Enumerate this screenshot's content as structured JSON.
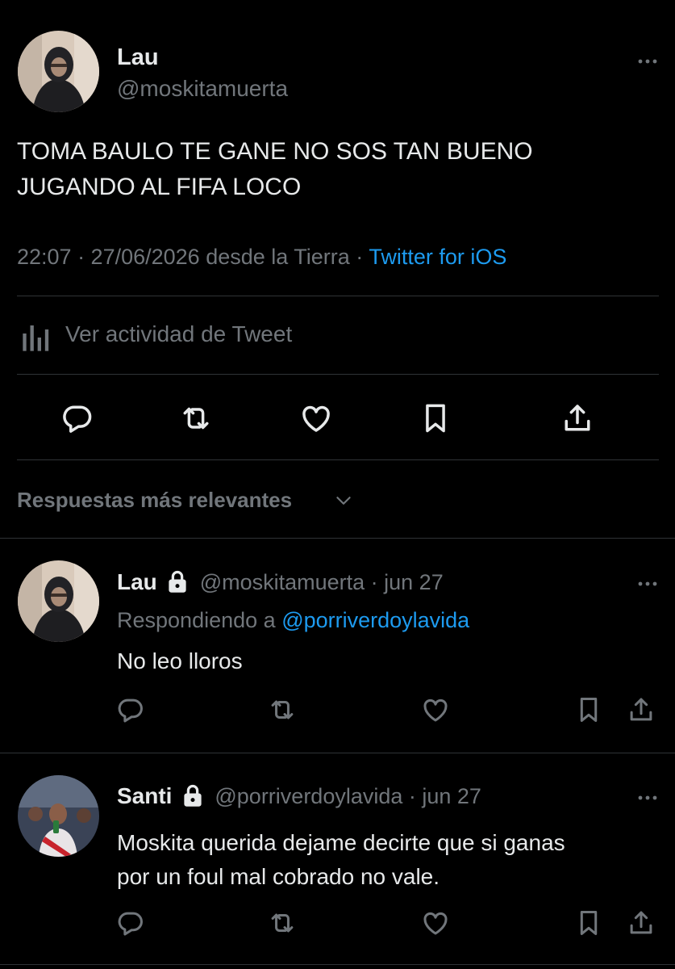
{
  "main_tweet": {
    "display_name": "Lau",
    "handle": "@moskitamuerta",
    "text_line1": "TOMA BAULO TE GANE NO SOS TAN BUENO",
    "text_line2": "JUGANDO AL FIFA LOCO",
    "meta_time": "22:07 · 27/06/2026 desde la Tierra ·",
    "meta_source": "Twitter for iOS",
    "activity_label": "Ver actividad de Tweet",
    "icons": [
      "more-icon",
      "analytics-icon",
      "reply-icon",
      "retweet-icon",
      "like-icon",
      "bookmark-icon",
      "share-icon"
    ]
  },
  "replies_header": {
    "label": "Respuestas más relevantes",
    "icon": "chevron-down-icon"
  },
  "replies": [
    {
      "display_name": "Lau",
      "handle_time": "@moskitamuerta · jun 27",
      "replying_to_prefix": "Respondiendo a",
      "replying_to_handle": "@porriverdoylavida",
      "text": "No leo lloros",
      "icons": [
        "lock-icon",
        "more-icon",
        "reply-icon",
        "retweet-icon",
        "like-icon",
        "bookmark-icon",
        "share-icon"
      ]
    },
    {
      "display_name": "Santi",
      "handle_time": "@porriverdoylavida · jun 27",
      "text_line1": "Moskita querida dejame decirte que si ganas",
      "text_line2": "por un foul mal cobrado no vale.",
      "icons": [
        "lock-icon",
        "more-icon",
        "reply-icon",
        "retweet-icon",
        "like-icon",
        "bookmark-icon",
        "share-icon"
      ]
    }
  ],
  "colors": {
    "background": "#000000",
    "text": "#e7e9ea",
    "muted": "#71767b",
    "link": "#1d9bf0",
    "divider": "#2f3336"
  }
}
